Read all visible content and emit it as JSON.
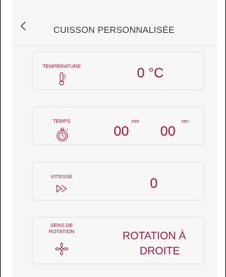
{
  "header": {
    "title": "CUISSON PERSONNALISÉE"
  },
  "cards": {
    "temperature": {
      "label": "TEMPÉRATURE",
      "value": "0 °C",
      "icon": "thermometer-icon"
    },
    "time": {
      "label": "TEMPS",
      "minutes": "00",
      "min_unit": "min",
      "seconds": "00",
      "sec_unit": "sec",
      "icon": "stopwatch-icon"
    },
    "speed": {
      "label": "VITESSE",
      "value": "0",
      "icon": "fast-forward-icon"
    },
    "rotation": {
      "label_line1": "SENS DE",
      "label_line2": "ROTATION",
      "value_line1": "ROTATION À",
      "value_line2": "DROITE",
      "icon": "fan-rotation-icon"
    }
  },
  "colors": {
    "accent": "#a4153b",
    "card_bg": "#f7f7f7",
    "card_border": "#ececec"
  }
}
